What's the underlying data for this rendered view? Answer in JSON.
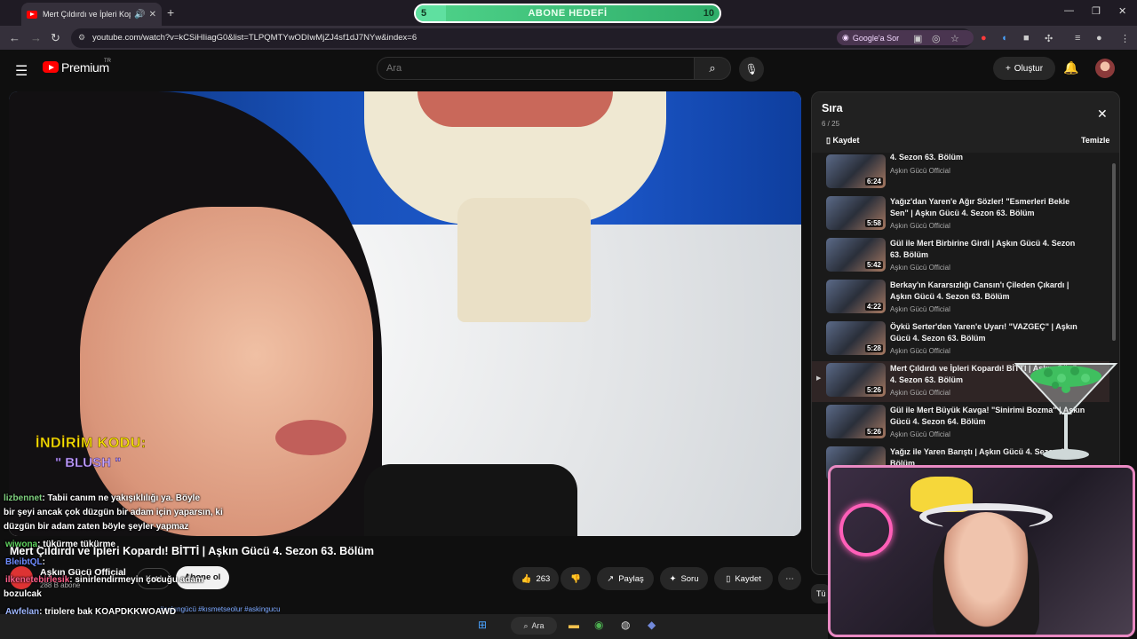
{
  "browser": {
    "tab_title": "Mert Çıldırdı ve İpleri Kopard",
    "url": "youtube.com/watch?v=kCSiHIiagG0&list=TLPQMTYwODIwMjZJ4sf1dJ7NYw&index=6",
    "google_sor_label": "Google'a Sor"
  },
  "goal": {
    "start": "5",
    "label": "ABONE HEDEFİ",
    "end": "10",
    "progress_fraction": 0.1
  },
  "youtube": {
    "premium_label": "Premium",
    "tr_label": "TR",
    "search_placeholder": "Ara",
    "create_label": "Oluştur"
  },
  "video": {
    "promo_line1": "İNDİRİM KODU:",
    "promo_line2": "\" BLUSH \"",
    "title": "Mert Çıldırdı ve İpleri Kopardı! BİTTİ | Aşkın Gücü 4. Sezon 63. Bölüm",
    "channel": "Aşkın Gücü Official",
    "subscribers": "288 B abone",
    "join_label": "Katıl",
    "subscribe_label": "Abone ol",
    "likes": "263",
    "share_label": "Paylaş",
    "ask_label": "Soru",
    "save_label": "Kaydet",
    "tags": "#aşkıngücü #kısmetseolur #askingucu"
  },
  "playlist": {
    "title": "Sıra",
    "count": "6 / 25",
    "save_label": "Kaydet",
    "clear_label": "Temizle",
    "items": [
      {
        "title": "4. Sezon 63. Bölüm",
        "channel": "Aşkın Gücü Official",
        "duration": "6:24"
      },
      {
        "title": "Yağız'dan Yaren'e Ağır Sözler! \"Esmerleri Bekle Sen\" | Aşkın Gücü 4. Sezon 63. Bölüm",
        "channel": "Aşkın Gücü Official",
        "duration": "5:58"
      },
      {
        "title": "Gül ile Mert Birbirine Girdi | Aşkın Gücü 4. Sezon 63. Bölüm",
        "channel": "Aşkın Gücü Official",
        "duration": "5:42"
      },
      {
        "title": "Berkay'ın Kararsızlığı Cansın'ı Çileden Çıkardı | Aşkın Gücü 4. Sezon 63. Bölüm",
        "channel": "Aşkın Gücü Official",
        "duration": "4:22"
      },
      {
        "title": "Öykü Serter'den Yaren'e Uyarı! \"VAZGEÇ\" | Aşkın Gücü 4. Sezon 63. Bölüm",
        "channel": "Aşkın Gücü Official",
        "duration": "5:28"
      },
      {
        "title": "Mert Çıldırdı ve İpleri Kopardı! BİTTİ | Aşkın Gücü 4. Sezon 63. Bölüm",
        "channel": "Aşkın Gücü Official",
        "duration": "5:26"
      },
      {
        "title": "Gül ile Mert Büyük Kavga! \"Sinirimi Bozma\" | Aşkın Gücü 4. Sezon 64. Bölüm",
        "channel": "Aşkın Gücü Official",
        "duration": "5:26"
      },
      {
        "title": "Yağız ile Yaren Barıştı | Aşkın Gücü 4. Sezon 64. Bölüm",
        "channel": "Aşkın Gücü Official",
        "duration": "5:47"
      }
    ]
  },
  "chat": [
    {
      "user": "lizbennet",
      "message": ": Tabii canım ne yakışıklılığı ya. Böyle",
      "user_color": "#7fd17f"
    },
    {
      "user": "",
      "message": "bir şeyi ancak çok düzgün bir adam için yaparsın, ki",
      "user_color": "#ffffff"
    },
    {
      "user": "",
      "message": "düzgün bir adam zaten böyle şeyler yapmaz",
      "user_color": "#ffffff"
    },
    {
      "user": "wiwona",
      "message": ": tükürme tükürme",
      "user_color": "#5fd35f"
    },
    {
      "user": "BleibtQL",
      "message": ":",
      "user_color": "#6f8cff"
    },
    {
      "user": "ilkenetebirlesik",
      "message": ": sinirlendirmeyin çocuğu adam",
      "user_color": "#ff5f8a"
    },
    {
      "user": "",
      "message": "bozulcak",
      "user_color": "#ffffff"
    },
    {
      "user": "Awfelan",
      "message": ": triplere bak KOAPDKKWOAWD",
      "user_color": "#9fb7ff"
    },
    {
      "user": "BleibtQL",
      "message": ":",
      "user_color": "#6f8cff"
    }
  ],
  "taskbar": {
    "search_label": "Ara"
  },
  "partial_button": "Tü",
  "colors": {
    "youtube_red": "#ff0000",
    "goal_green": "#4fd38a",
    "webcam_border": "#e98ac3"
  }
}
